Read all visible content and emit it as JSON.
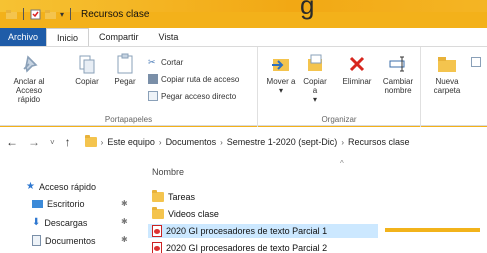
{
  "window": {
    "title": "Recursos clase"
  },
  "background": {
    "glyph_text": "g",
    "accent": "#f2b31b"
  },
  "tabs": [
    {
      "label": "Archivo"
    },
    {
      "label": "Inicio"
    },
    {
      "label": "Compartir"
    },
    {
      "label": "Vista"
    }
  ],
  "ribbon": {
    "portapapeles": {
      "label": "Portapapeles",
      "anclar": "Anclar al Acceso rápido",
      "copiar": "Copiar",
      "pegar": "Pegar",
      "cortar": "Cortar",
      "copiar_ruta": "Copiar ruta de acceso",
      "pegar_acceso": "Pegar acceso directo"
    },
    "organizar": {
      "label": "Organizar",
      "mover": "Mover a",
      "copiar_a": "Copiar a",
      "eliminar": "Eliminar",
      "cambiar": "Cambiar nombre"
    },
    "nuevo": {
      "nueva_carpeta": "Nueva carpeta"
    }
  },
  "address": {
    "crumbs": [
      "Este equipo",
      "Documentos",
      "Semestre 1-2020 (sept-Dic)",
      "Recursos clase"
    ]
  },
  "sidebar": {
    "items": [
      {
        "label": "Acceso rápido"
      },
      {
        "label": "Escritorio"
      },
      {
        "label": "Descargas"
      },
      {
        "label": "Documentos"
      }
    ]
  },
  "list": {
    "column": "Nombre",
    "items": [
      {
        "name": "Tareas"
      },
      {
        "name": "Videos clase"
      },
      {
        "name": "2020 GI procesadores de texto Parcial 1"
      },
      {
        "name": "2020 GI procesadores de texto Parcial 2"
      }
    ]
  }
}
